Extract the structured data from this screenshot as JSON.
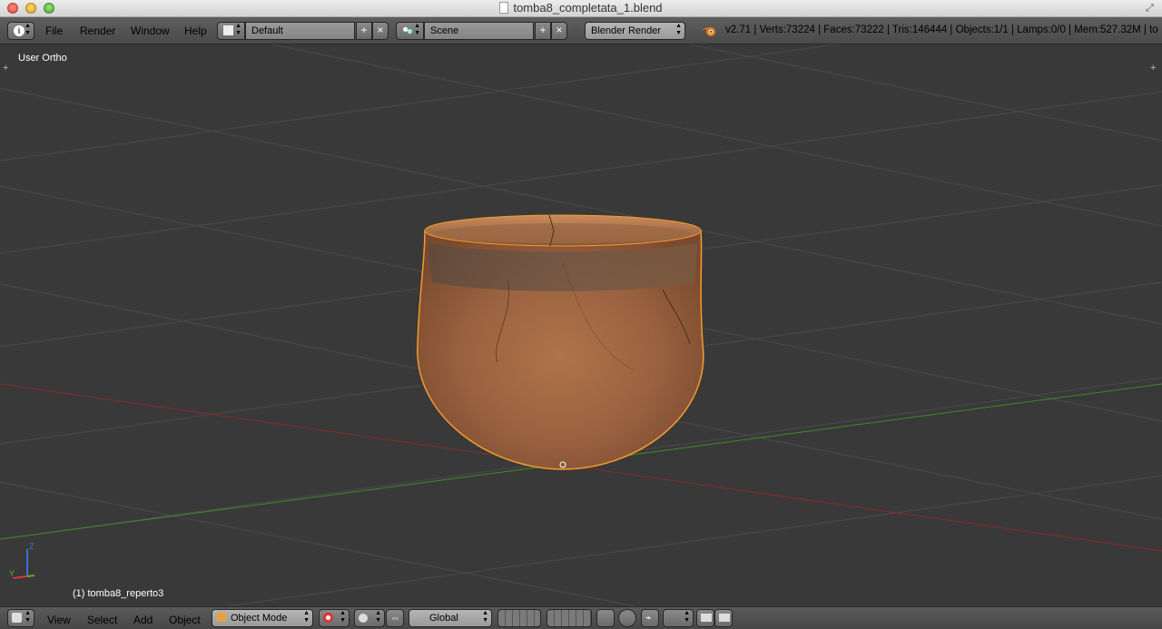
{
  "window": {
    "title": "tomba8_completata_1.blend"
  },
  "header": {
    "menus": [
      "File",
      "Render",
      "Window",
      "Help"
    ],
    "screen_layout": "Default",
    "scene": "Scene",
    "render_engine": "Blender Render",
    "stats": "v2.71 | Verts:73224 | Faces:73222 | Tris:146444 | Objects:1/1 | Lamps:0/0 | Mem:527.32M | to"
  },
  "viewport": {
    "view_label": "User Ortho",
    "object_label": "(1) tomba8_reperto3",
    "axis_z": "Z",
    "axis_y": "Y"
  },
  "footer": {
    "menus": [
      "View",
      "Select",
      "Add",
      "Object"
    ],
    "mode": "Object Mode",
    "orientation": "Global"
  },
  "colors": {
    "viewport_bg": "#393939",
    "x_axis": "#8a2a2a",
    "y_axis": "#3f8a2a",
    "selection_outline": "#f29b2f"
  },
  "icons": [
    "info-icon",
    "layout-icon",
    "scene-icon",
    "blender-logo-icon",
    "view3d-icon",
    "mode-cube-icon",
    "shading-icon",
    "pivot-icon",
    "manipulator-icon",
    "layers-icon",
    "snap-icon",
    "render-icon"
  ]
}
